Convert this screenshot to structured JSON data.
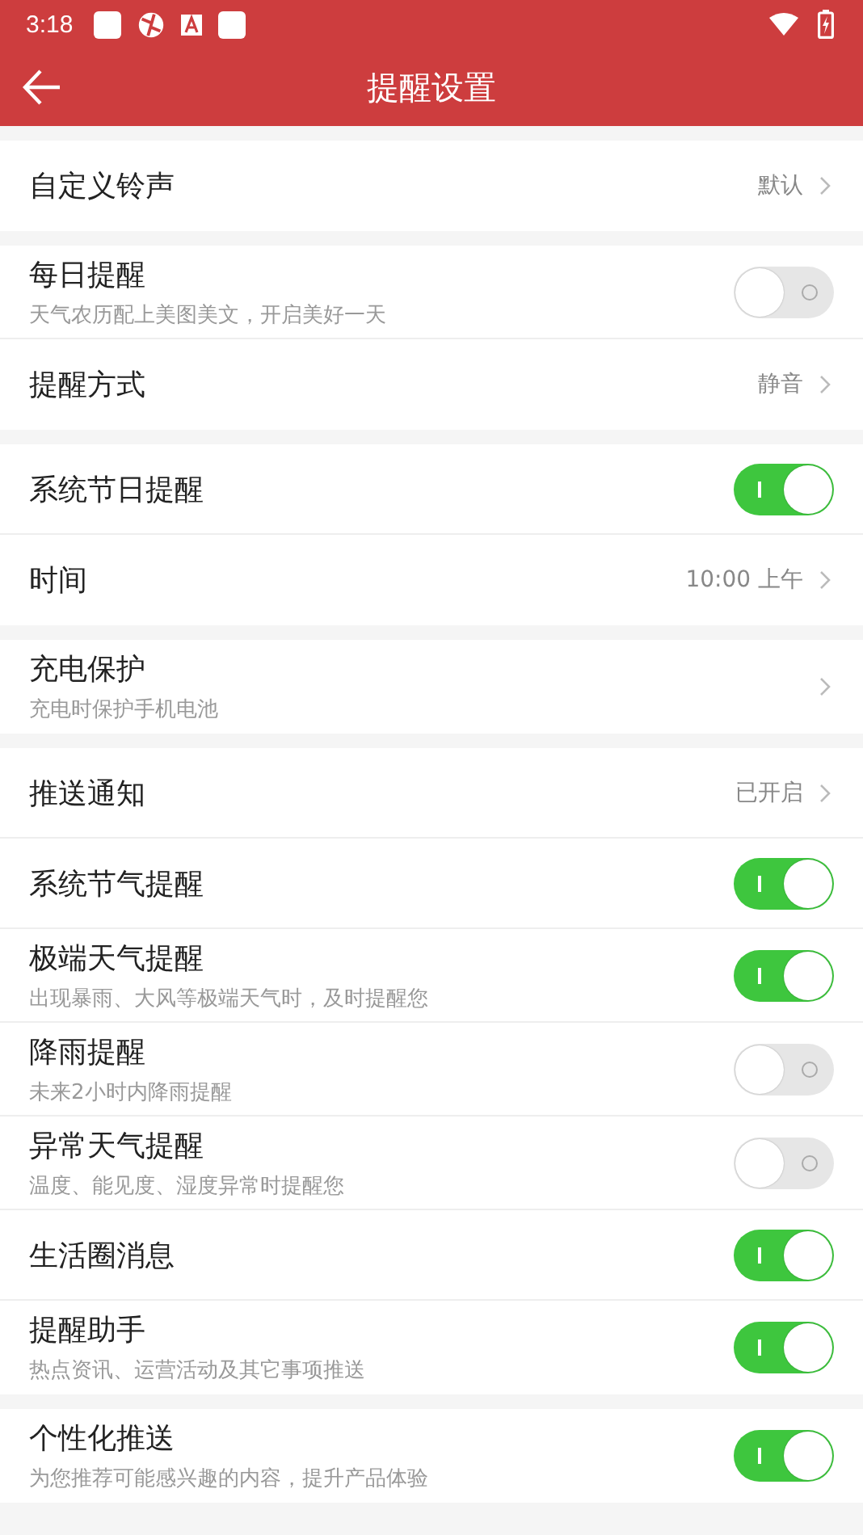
{
  "status_bar": {
    "time": "3:18"
  },
  "header": {
    "title": "提醒设置"
  },
  "groups": [
    {
      "rows": [
        {
          "kind": "link",
          "title": "自定义铃声",
          "value": "默认"
        }
      ]
    },
    {
      "rows": [
        {
          "kind": "toggle",
          "title": "每日提醒",
          "subtitle": "天气农历配上美图美文，开启美好一天",
          "on": false
        },
        {
          "kind": "link",
          "title": "提醒方式",
          "value": "静音"
        }
      ]
    },
    {
      "rows": [
        {
          "kind": "toggle",
          "title": "系统节日提醒",
          "on": true
        },
        {
          "kind": "link",
          "title": "时间",
          "value": "10:00 上午"
        }
      ]
    },
    {
      "rows": [
        {
          "kind": "link",
          "title": "充电保护",
          "subtitle": "充电时保护手机电池"
        }
      ]
    },
    {
      "rows": [
        {
          "kind": "link",
          "title": "推送通知",
          "value": "已开启"
        },
        {
          "kind": "toggle",
          "title": "系统节气提醒",
          "on": true
        },
        {
          "kind": "toggle",
          "title": "极端天气提醒",
          "subtitle": "出现暴雨、大风等极端天气时，及时提醒您",
          "on": true
        },
        {
          "kind": "toggle",
          "title": "降雨提醒",
          "subtitle": "未来2小时内降雨提醒",
          "on": false
        },
        {
          "kind": "toggle",
          "title": "异常天气提醒",
          "subtitle": "温度、能见度、湿度异常时提醒您",
          "on": false
        },
        {
          "kind": "toggle",
          "title": "生活圈消息",
          "on": true
        },
        {
          "kind": "toggle",
          "title": "提醒助手",
          "subtitle": "热点资讯、运营活动及其它事项推送",
          "on": true
        }
      ]
    },
    {
      "rows": [
        {
          "kind": "toggle",
          "title": "个性化推送",
          "subtitle": "为您推荐可能感兴趣的内容，提升产品体验",
          "on": true
        }
      ]
    }
  ]
}
